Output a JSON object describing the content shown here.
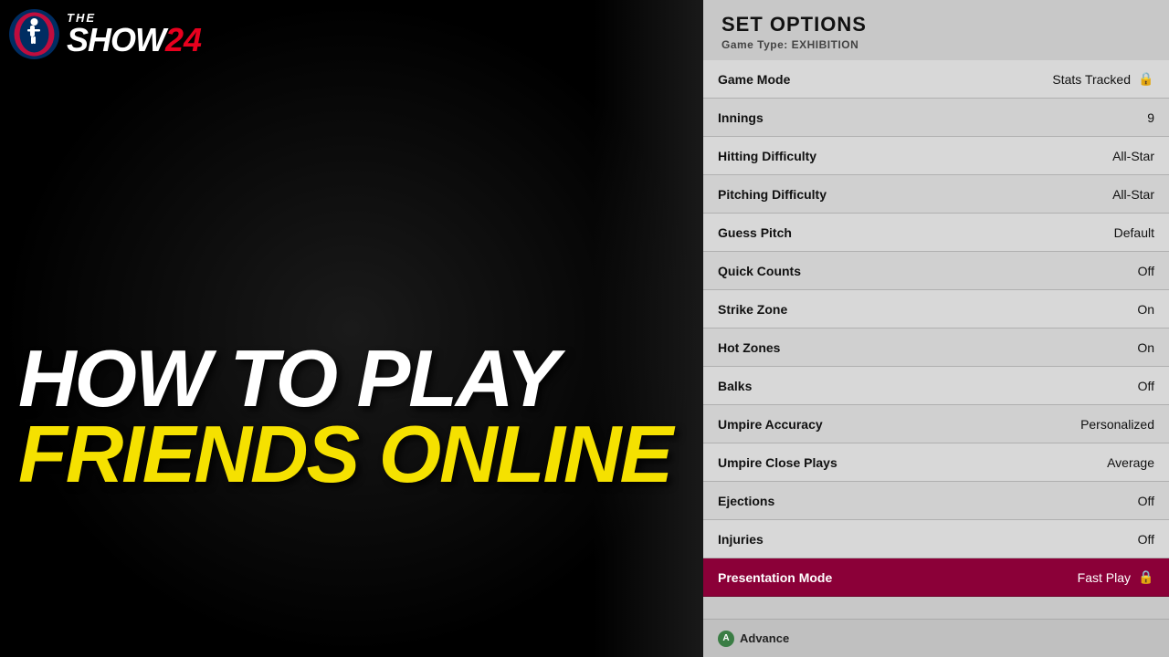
{
  "left": {
    "logo": {
      "the": "THE",
      "show": "SHOW",
      "number": "24"
    },
    "howToPlay": "HOW TO PLAY",
    "friendsOnline": "FRIENDS ONLINE"
  },
  "right": {
    "header": {
      "title": "SET OPTIONS",
      "gameType": "Game Type: EXHIBITION"
    },
    "options": [
      {
        "label": "Game Mode",
        "value": "Stats Tracked",
        "hasLock": true,
        "highlighted": false
      },
      {
        "label": "Innings",
        "value": "9",
        "hasLock": false,
        "highlighted": false
      },
      {
        "label": "Hitting Difficulty",
        "value": "All-Star",
        "hasLock": false,
        "highlighted": false
      },
      {
        "label": "Pitching Difficulty",
        "value": "All-Star",
        "hasLock": false,
        "highlighted": false
      },
      {
        "label": "Guess Pitch",
        "value": "Default",
        "hasLock": false,
        "highlighted": false
      },
      {
        "label": "Quick Counts",
        "value": "Off",
        "hasLock": false,
        "highlighted": false
      },
      {
        "label": "Strike Zone",
        "value": "On",
        "hasLock": false,
        "highlighted": false
      },
      {
        "label": "Hot Zones",
        "value": "On",
        "hasLock": false,
        "highlighted": false
      },
      {
        "label": "Balks",
        "value": "Off",
        "hasLock": false,
        "highlighted": false
      },
      {
        "label": "Umpire Accuracy",
        "value": "Personalized",
        "hasLock": false,
        "highlighted": false
      },
      {
        "label": "Umpire Close Plays",
        "value": "Average",
        "hasLock": false,
        "highlighted": false
      },
      {
        "label": "Ejections",
        "value": "Off",
        "hasLock": false,
        "highlighted": false
      },
      {
        "label": "Injuries",
        "value": "Off",
        "hasLock": false,
        "highlighted": false
      },
      {
        "label": "Presentation Mode",
        "value": "Fast Play",
        "hasLock": true,
        "highlighted": true
      }
    ],
    "footer": {
      "buttonIcon": "A",
      "buttonLabel": "Advance"
    }
  }
}
